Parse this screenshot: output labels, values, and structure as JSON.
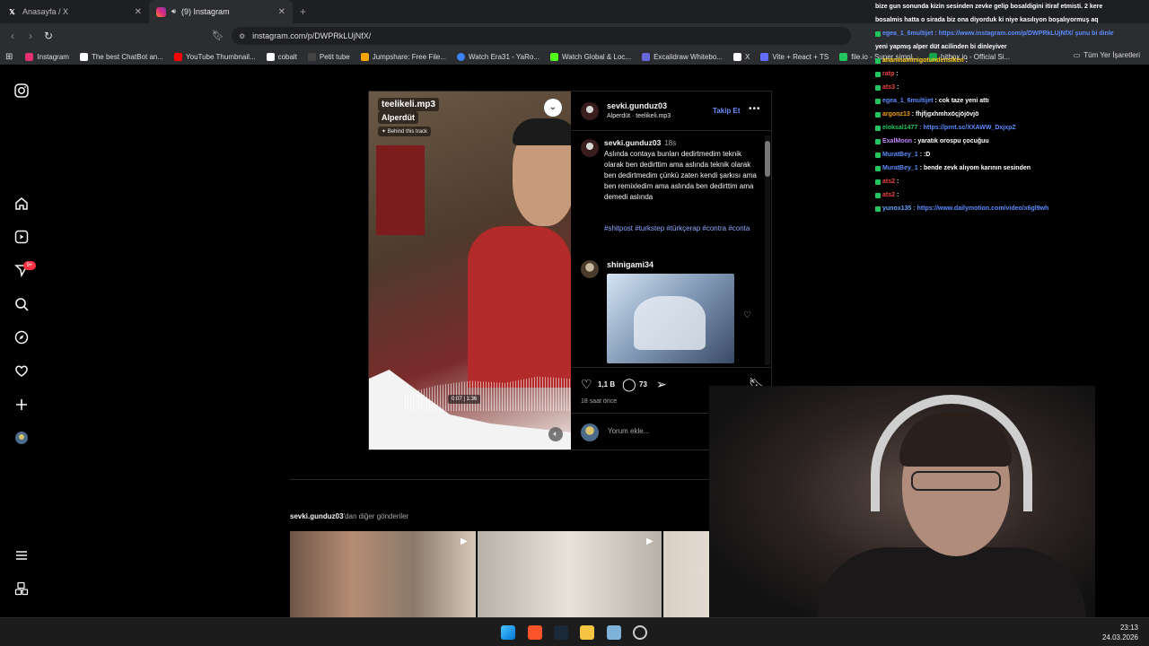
{
  "browser": {
    "tabs": [
      {
        "label": "Anasayfa / X",
        "favicon": "X"
      },
      {
        "label": "(9) Instagram",
        "favicon": "IG"
      }
    ],
    "url": "instagram.com/p/DWPRkLUjNfX/",
    "bookmarks": [
      {
        "label": "Instagram",
        "color": "#e1306c"
      },
      {
        "label": "The best ChatBot an...",
        "color": "#ffffff"
      },
      {
        "label": "YouTube Thumbnail...",
        "color": "#ff0000"
      },
      {
        "label": "cobalt",
        "color": "#ffffff"
      },
      {
        "label": "Petit tube",
        "color": "#222222"
      },
      {
        "label": "Jumpshare: Free File...",
        "color": "#f7a600"
      },
      {
        "label": "Watch Era31 - YaRo...",
        "color": "#3b82f6"
      },
      {
        "label": "Watch Global & Loc...",
        "color": "#53fc18"
      },
      {
        "label": "Excalidraw Whitebo...",
        "color": "#6965db"
      },
      {
        "label": "X",
        "color": "#ffffff"
      },
      {
        "label": "Vite + React + TS",
        "color": "#646cff"
      },
      {
        "label": "file.io - Super simpl...",
        "color": "#22c55e"
      },
      {
        "label": "hitbox.io - Official Si...",
        "color": "#16a34a"
      }
    ],
    "bookmarks_all": "Tüm Yer İşaretleri"
  },
  "post": {
    "song_title": "teelikeli.mp3",
    "song_artist": "Alperdüt",
    "behind_track": "Behind this track",
    "timecode": "0:07 | 1:36",
    "author": "sevki.gunduz03",
    "audio_line": "Alperdüt · teelikeli.mp3",
    "follow_label": "Takip Et",
    "caption_user": "sevki.gunduz03",
    "caption_time": "18s",
    "caption": "Aslında contaya bunları dedirtmedim teknik olarak ben dedirttim ama aslında teknik olarak ben dedirtmedim çünkü zaten kendi şarkısı ama ben remixledim ama aslında ben dedirttim ama demedi aslında",
    "tags": "#shitpost #turkstep #türkçerap  #contra #conta",
    "commenter": "shinigami34",
    "likes": "1,1 B",
    "comments": "73",
    "posted": "18 saat önce",
    "comment_placeholder": "Yorum ekle..."
  },
  "more_posts": {
    "user": "sevki.gunduz03",
    "suffix": "'dan diğer gönderiler"
  },
  "chat": [
    {
      "user": "",
      "user_color": "#ffffff",
      "text": "bize gun sonunda kizin sesinden zevke gelip bosaldigini itiraf etmisti. 2 kere"
    },
    {
      "user": "",
      "user_color": "#ffffff",
      "text": "bosalmis hatta o sirada biz ona diyorduk ki niye kasılıyon boşalıyormuş aq"
    },
    {
      "user": "egea_1_6multijet",
      "user_color": "#5b8cff",
      "text": ": https://www.instagram.com/p/DWPRkLUjNfX/ şunu bi dinle"
    },
    {
      "user": "",
      "user_color": "#ffffff",
      "text": "yeni yapmış alper düt acilinden bi dinleyiver"
    },
    {
      "user": "ananinaminigotundensiken",
      "user_color": "#facc15",
      "text": ":"
    },
    {
      "user": "ratp",
      "user_color": "#ef4444",
      "text": ":"
    },
    {
      "user": "ats3",
      "user_color": "#ef4444",
      "text": ":"
    },
    {
      "user": "egea_1_6multijet",
      "user_color": "#5b8cff",
      "text": ": cok taze yeni attı"
    },
    {
      "user": "argonz13",
      "user_color": "#f59e0b",
      "text": ": fhjfjgxhmhxöçjöjövjö"
    },
    {
      "user": "eloksal1477",
      "user_color": "#22c55e",
      "text": ": https://prnt.sc/XXAWW_DxjxpZ"
    },
    {
      "user": "ExalMoon",
      "user_color": "#c084fc",
      "text": ": yaratık orospu çocuğuu"
    },
    {
      "user": "MuratBey_1",
      "user_color": "#5b8cff",
      "text": ": :D"
    },
    {
      "user": "MuratBey_1",
      "user_color": "#5b8cff",
      "text": ": bende zevk alıyom karının sesinden"
    },
    {
      "user": "ats2",
      "user_color": "#ef4444",
      "text": ":"
    },
    {
      "user": "ats2",
      "user_color": "#ef4444",
      "text": ":"
    },
    {
      "user": "yunox135",
      "user_color": "#60a5fa",
      "text": ": https://www.dailymotion.com/video/x6gl9wh"
    }
  ],
  "clock": {
    "time": "23:13",
    "date": "24.03.2026"
  }
}
